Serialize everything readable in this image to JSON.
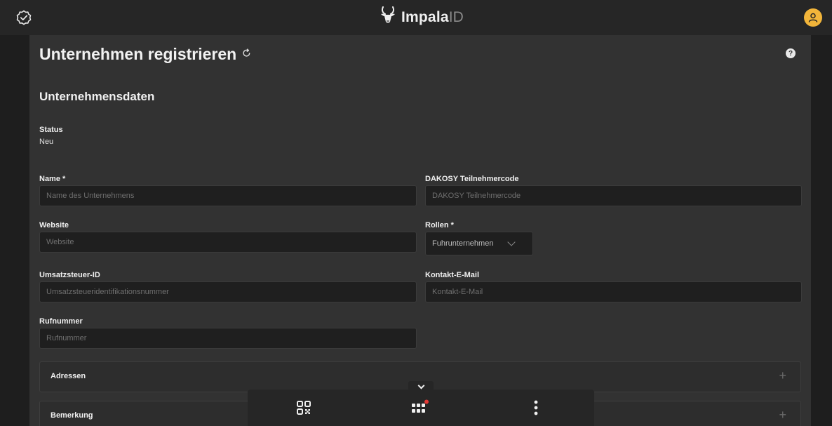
{
  "header": {
    "brand_name": "Impala",
    "brand_suffix": "ID",
    "icons": [
      "check-badge-icon",
      "impala-logo-icon",
      "user-avatar-icon"
    ]
  },
  "page": {
    "title": "Unternehmen registrieren",
    "section_title": "Unternehmensdaten",
    "status_label": "Status",
    "status_value": "Neu"
  },
  "form": {
    "name_label": "Name *",
    "name_placeholder": "Name des Unternehmens",
    "dakosy_label": "DAKOSY Teilnehmercode",
    "dakosy_placeholder": "DAKOSY Teilnehmercode",
    "website_label": "Website",
    "website_placeholder": "Website",
    "roles_label": "Rollen *",
    "roles_value": "Fuhrunternehmen",
    "vat_label": "Umsatzsteuer-ID",
    "vat_placeholder": "Umsatzsteueridentifikationsnummer",
    "email_label": "Kontakt-E-Mail",
    "email_placeholder": "Kontakt-E-Mail",
    "phone_label": "Rufnummer",
    "phone_placeholder": "Rufnummer"
  },
  "sections": {
    "addresses": "Adressen",
    "remarks": "Bemerkung"
  },
  "colors": {
    "accent": "#f2b53a",
    "notification": "#e53935",
    "background": "#1e1e1e",
    "panel": "#323232",
    "input": "#1f1f1f"
  }
}
